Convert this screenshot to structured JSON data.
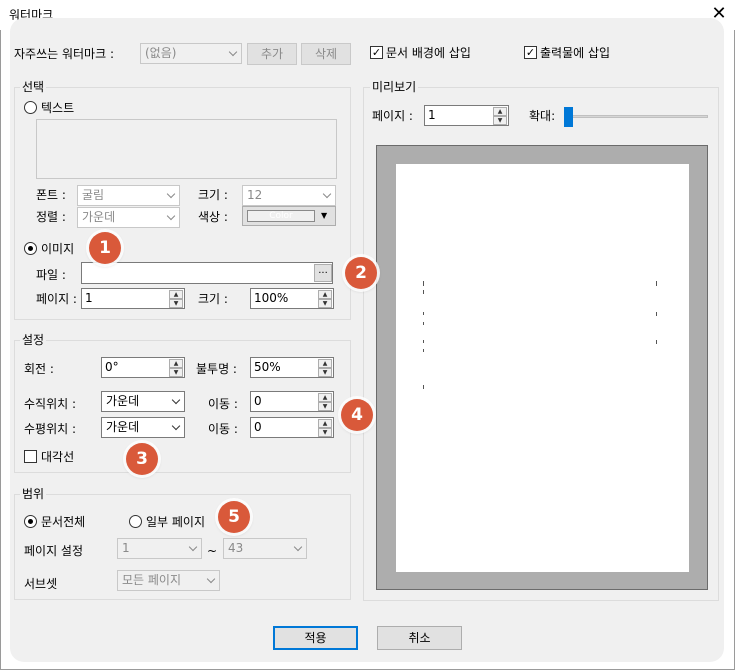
{
  "window": {
    "title": "워터마크"
  },
  "top": {
    "frequent_label": "자주쓰는 워터마크 :",
    "frequent_value": "(없음)",
    "add_button": "추가",
    "delete_button": "삭제",
    "insert_background_label": "문서 배경에 삽입",
    "insert_output_label": "출력물에 삽입",
    "insert_background_checked": true,
    "insert_output_checked": true
  },
  "selection": {
    "group_title": "선택",
    "text_radio": "텍스트",
    "font_label": "폰트 :",
    "font_value": "굴림",
    "size_label": "크기 :",
    "size_value": "12",
    "align_label": "정렬 :",
    "align_value": "가운데",
    "color_label": "색상 :",
    "color_value": "Color",
    "image_radio": "이미지",
    "file_label": "파일 :",
    "file_value": "",
    "browse_button": "...",
    "page_label": "페이지 :",
    "page_value": "1",
    "scale_label": "크기 :",
    "scale_value": "100%"
  },
  "settings": {
    "group_title": "설정",
    "rotation_label": "회전 :",
    "rotation_value": "0°",
    "opacity_label": "불투명 :",
    "opacity_value": "50%",
    "vertical_label": "수직위치 :",
    "vertical_value": "가운데",
    "vertical_move_label": "이동 :",
    "vertical_move_value": "0",
    "horizontal_label": "수평위치 :",
    "horizontal_value": "가운데",
    "horizontal_move_label": "이동 :",
    "horizontal_move_value": "0",
    "diagonal_label": "대각선",
    "diagonal_checked": false
  },
  "range": {
    "group_title": "범위",
    "all_pages_radio": "문서전체",
    "some_pages_radio": "일부 페이지",
    "page_setting_label": "페이지 설정",
    "from_value": "1",
    "tilde": "~",
    "to_value": "43",
    "subset_label": "서브셋",
    "subset_value": "모든 페이지"
  },
  "preview": {
    "group_title": "미리보기",
    "page_label": "페이지 :",
    "page_value": "1",
    "zoom_label": "확대:",
    "zoom_level": 0
  },
  "footer": {
    "apply_button": "적용",
    "cancel_button": "취소"
  },
  "badges": [
    "1",
    "2",
    "3",
    "4",
    "5"
  ],
  "colors": {
    "badge": "#d9593a",
    "accent": "#0078d7",
    "preview_bg": "#adadad"
  },
  "icons": {
    "close": "close-icon",
    "dropdown": "chevron-down-icon",
    "spin": "spin-arrows-icon"
  }
}
